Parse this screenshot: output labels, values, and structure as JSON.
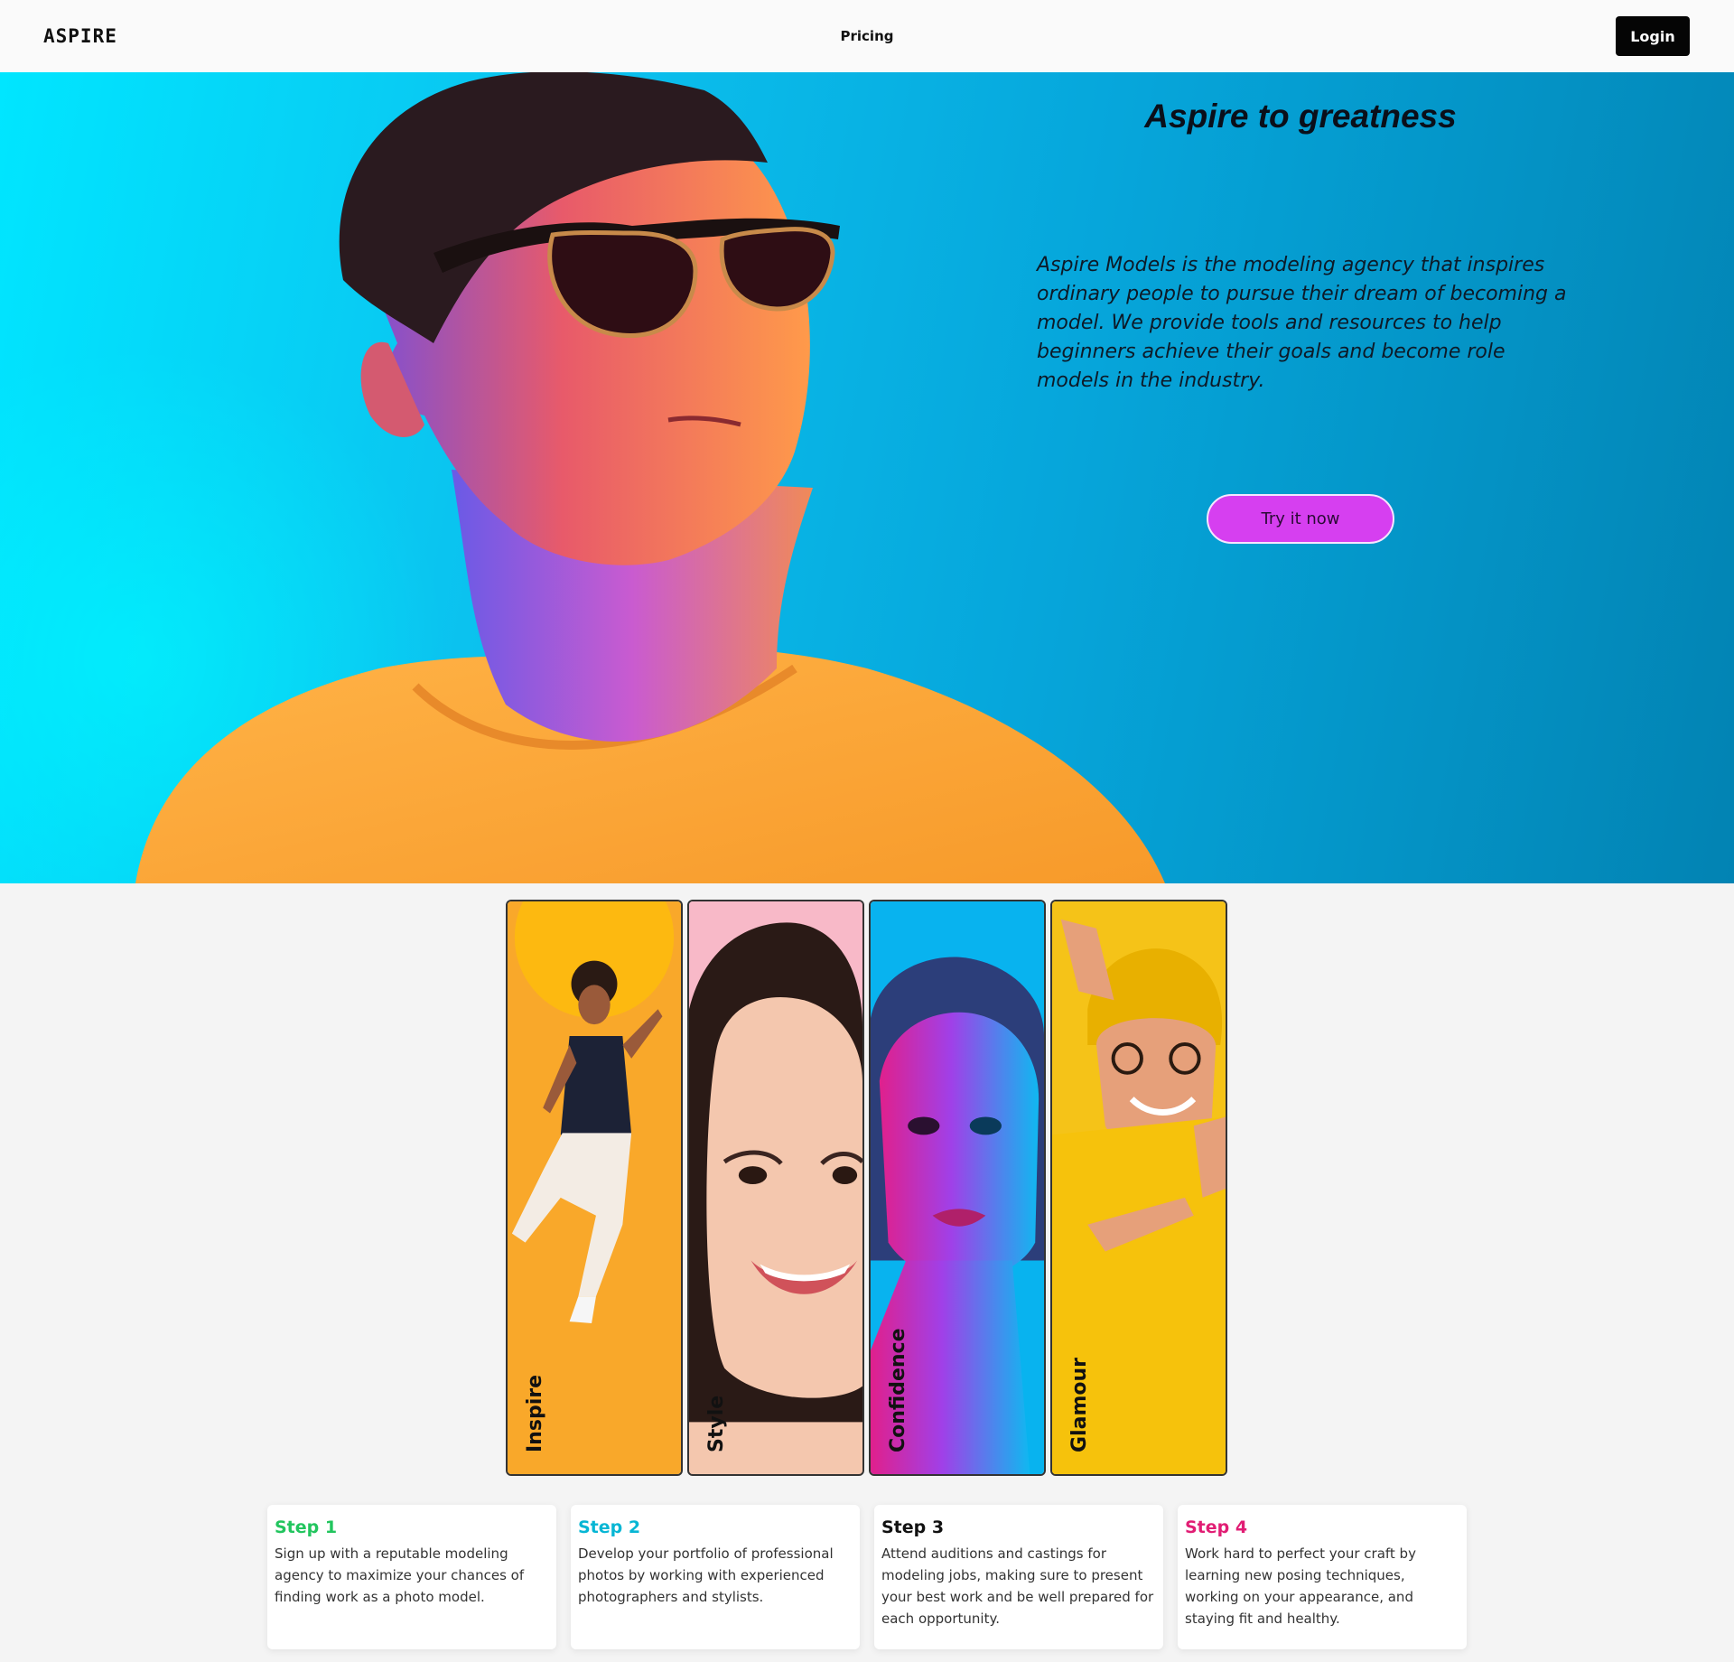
{
  "nav": {
    "brand": "ASPIRE",
    "pricing_label": "Pricing",
    "login_label": "Login"
  },
  "hero": {
    "title": "Aspire to greatness",
    "description": "Aspire Models is the modeling agency that inspires ordinary people to pursue their dream of becoming a model. We provide tools and resources to help beginners achieve their goals and become role models in the industry.",
    "cta_label": "Try it now"
  },
  "cards": [
    {
      "label": "Inspire",
      "bg": "#f9a82a"
    },
    {
      "label": "Style",
      "bg": "#f8b9c8"
    },
    {
      "label": "Confidence",
      "bg": "#08b3ef"
    },
    {
      "label": "Glamour",
      "bg": "#f5c318"
    }
  ],
  "steps": [
    {
      "title": "Step 1",
      "color": "#22c55e",
      "text": "Sign up with a reputable modeling agency to maximize your chances of finding work as a photo model."
    },
    {
      "title": "Step 2",
      "color": "#06b6d4",
      "text": "Develop your portfolio of professional photos by working with experienced photographers and stylists."
    },
    {
      "title": "Step 3",
      "color": "#111111",
      "text": "Attend auditions and castings for modeling jobs, making sure to present your best work and be well prepared for each opportunity."
    },
    {
      "title": "Step 4",
      "color": "#e11d74",
      "text": "Work hard to perfect your craft by learning new posing techniques, working on your appearance, and staying fit and healthy."
    }
  ]
}
